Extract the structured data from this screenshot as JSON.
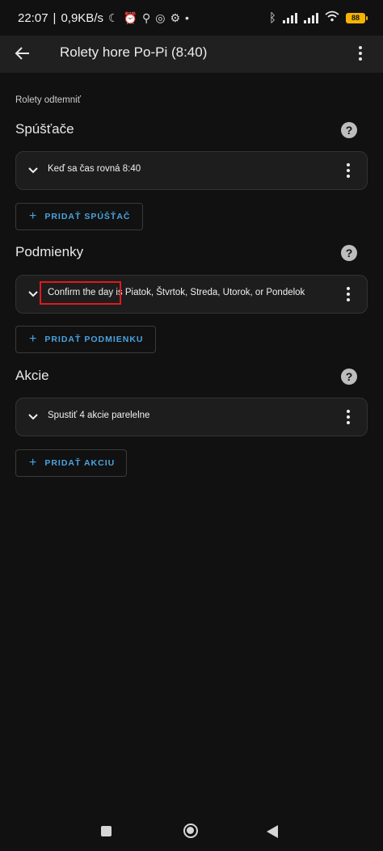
{
  "status_bar": {
    "time": "22:07",
    "net_speed": "0,9KB/s",
    "battery": "88",
    "icons": [
      "moon-icon",
      "alarm-off-icon",
      "usb-icon",
      "whatsapp-icon",
      "gear-icon",
      "bluetooth-icon",
      "signal-icon",
      "signal-icon",
      "wifi-icon",
      "battery-icon"
    ]
  },
  "app_bar": {
    "title": "Rolety hore Po-Pi (8:40)"
  },
  "main": {
    "subtitle": "Rolety odtemniť",
    "sections": [
      {
        "heading": "Spúšťače",
        "card_text": "Keď sa čas rovná 8:40",
        "add_label": "PRIDAŤ SPÚŠŤAČ"
      },
      {
        "heading": "Podmienky",
        "card_text": "Confirm the day is Piatok, Štvrtok, Streda, Utorok, or Pondelok",
        "add_label": "PRIDAŤ PODMIENKU"
      },
      {
        "heading": "Akcie",
        "card_text": "Spustiť 4 akcie parelelne",
        "add_label": "PRIDAŤ AKCIU"
      }
    ]
  },
  "colors": {
    "accent": "#4aa3df",
    "highlight": "#e0191e",
    "background": "#111111",
    "card": "#1d1d1d"
  }
}
